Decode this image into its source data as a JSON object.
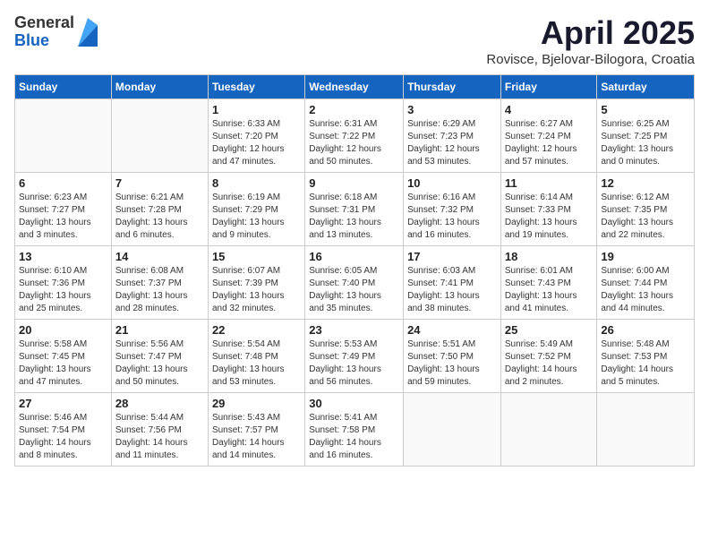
{
  "header": {
    "logo": {
      "line1": "General",
      "line2": "Blue"
    },
    "title": "April 2025",
    "subtitle": "Rovisce, Bjelovar-Bilogora, Croatia"
  },
  "weekdays": [
    "Sunday",
    "Monday",
    "Tuesday",
    "Wednesday",
    "Thursday",
    "Friday",
    "Saturday"
  ],
  "weeks": [
    [
      {
        "day": "",
        "info": ""
      },
      {
        "day": "",
        "info": ""
      },
      {
        "day": "1",
        "info": "Sunrise: 6:33 AM\nSunset: 7:20 PM\nDaylight: 12 hours\nand 47 minutes."
      },
      {
        "day": "2",
        "info": "Sunrise: 6:31 AM\nSunset: 7:22 PM\nDaylight: 12 hours\nand 50 minutes."
      },
      {
        "day": "3",
        "info": "Sunrise: 6:29 AM\nSunset: 7:23 PM\nDaylight: 12 hours\nand 53 minutes."
      },
      {
        "day": "4",
        "info": "Sunrise: 6:27 AM\nSunset: 7:24 PM\nDaylight: 12 hours\nand 57 minutes."
      },
      {
        "day": "5",
        "info": "Sunrise: 6:25 AM\nSunset: 7:25 PM\nDaylight: 13 hours\nand 0 minutes."
      }
    ],
    [
      {
        "day": "6",
        "info": "Sunrise: 6:23 AM\nSunset: 7:27 PM\nDaylight: 13 hours\nand 3 minutes."
      },
      {
        "day": "7",
        "info": "Sunrise: 6:21 AM\nSunset: 7:28 PM\nDaylight: 13 hours\nand 6 minutes."
      },
      {
        "day": "8",
        "info": "Sunrise: 6:19 AM\nSunset: 7:29 PM\nDaylight: 13 hours\nand 9 minutes."
      },
      {
        "day": "9",
        "info": "Sunrise: 6:18 AM\nSunset: 7:31 PM\nDaylight: 13 hours\nand 13 minutes."
      },
      {
        "day": "10",
        "info": "Sunrise: 6:16 AM\nSunset: 7:32 PM\nDaylight: 13 hours\nand 16 minutes."
      },
      {
        "day": "11",
        "info": "Sunrise: 6:14 AM\nSunset: 7:33 PM\nDaylight: 13 hours\nand 19 minutes."
      },
      {
        "day": "12",
        "info": "Sunrise: 6:12 AM\nSunset: 7:35 PM\nDaylight: 13 hours\nand 22 minutes."
      }
    ],
    [
      {
        "day": "13",
        "info": "Sunrise: 6:10 AM\nSunset: 7:36 PM\nDaylight: 13 hours\nand 25 minutes."
      },
      {
        "day": "14",
        "info": "Sunrise: 6:08 AM\nSunset: 7:37 PM\nDaylight: 13 hours\nand 28 minutes."
      },
      {
        "day": "15",
        "info": "Sunrise: 6:07 AM\nSunset: 7:39 PM\nDaylight: 13 hours\nand 32 minutes."
      },
      {
        "day": "16",
        "info": "Sunrise: 6:05 AM\nSunset: 7:40 PM\nDaylight: 13 hours\nand 35 minutes."
      },
      {
        "day": "17",
        "info": "Sunrise: 6:03 AM\nSunset: 7:41 PM\nDaylight: 13 hours\nand 38 minutes."
      },
      {
        "day": "18",
        "info": "Sunrise: 6:01 AM\nSunset: 7:43 PM\nDaylight: 13 hours\nand 41 minutes."
      },
      {
        "day": "19",
        "info": "Sunrise: 6:00 AM\nSunset: 7:44 PM\nDaylight: 13 hours\nand 44 minutes."
      }
    ],
    [
      {
        "day": "20",
        "info": "Sunrise: 5:58 AM\nSunset: 7:45 PM\nDaylight: 13 hours\nand 47 minutes."
      },
      {
        "day": "21",
        "info": "Sunrise: 5:56 AM\nSunset: 7:47 PM\nDaylight: 13 hours\nand 50 minutes."
      },
      {
        "day": "22",
        "info": "Sunrise: 5:54 AM\nSunset: 7:48 PM\nDaylight: 13 hours\nand 53 minutes."
      },
      {
        "day": "23",
        "info": "Sunrise: 5:53 AM\nSunset: 7:49 PM\nDaylight: 13 hours\nand 56 minutes."
      },
      {
        "day": "24",
        "info": "Sunrise: 5:51 AM\nSunset: 7:50 PM\nDaylight: 13 hours\nand 59 minutes."
      },
      {
        "day": "25",
        "info": "Sunrise: 5:49 AM\nSunset: 7:52 PM\nDaylight: 14 hours\nand 2 minutes."
      },
      {
        "day": "26",
        "info": "Sunrise: 5:48 AM\nSunset: 7:53 PM\nDaylight: 14 hours\nand 5 minutes."
      }
    ],
    [
      {
        "day": "27",
        "info": "Sunrise: 5:46 AM\nSunset: 7:54 PM\nDaylight: 14 hours\nand 8 minutes."
      },
      {
        "day": "28",
        "info": "Sunrise: 5:44 AM\nSunset: 7:56 PM\nDaylight: 14 hours\nand 11 minutes."
      },
      {
        "day": "29",
        "info": "Sunrise: 5:43 AM\nSunset: 7:57 PM\nDaylight: 14 hours\nand 14 minutes."
      },
      {
        "day": "30",
        "info": "Sunrise: 5:41 AM\nSunset: 7:58 PM\nDaylight: 14 hours\nand 16 minutes."
      },
      {
        "day": "",
        "info": ""
      },
      {
        "day": "",
        "info": ""
      },
      {
        "day": "",
        "info": ""
      }
    ]
  ]
}
